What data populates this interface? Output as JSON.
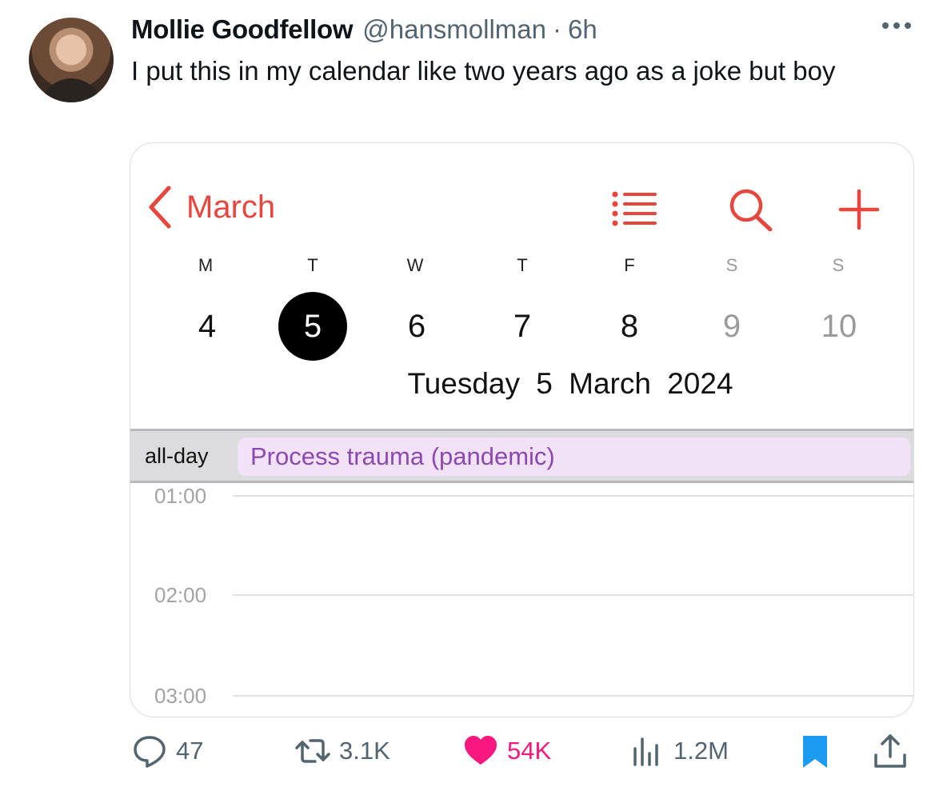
{
  "tweet": {
    "author_name": "Mollie Goodfellow",
    "handle": "@hansmollman",
    "separator": "·",
    "time": "6h",
    "text": "I put this in my calendar like two years ago as a joke but boy"
  },
  "calendar": {
    "back_label": "March",
    "accent_color": "#e8453c",
    "weekdays": [
      "M",
      "T",
      "W",
      "T",
      "F",
      "S",
      "S"
    ],
    "days": [
      "4",
      "5",
      "6",
      "7",
      "8",
      "9",
      "10"
    ],
    "selected_day": "5",
    "date_label": "Tuesday 5 March 2024",
    "allday_label": "all-day",
    "event": {
      "title": "Process trauma (pandemic)",
      "color": "#f1e2f8",
      "text_color": "#8c48b3"
    },
    "hours": [
      "01:00",
      "02:00",
      "03:00"
    ]
  },
  "actions": {
    "replies": "47",
    "reposts": "3.1K",
    "likes": "54K",
    "views": "1.2M",
    "like_color": "#f91880",
    "bookmark_color": "#1d9bf0",
    "icon_color": "#536471"
  }
}
